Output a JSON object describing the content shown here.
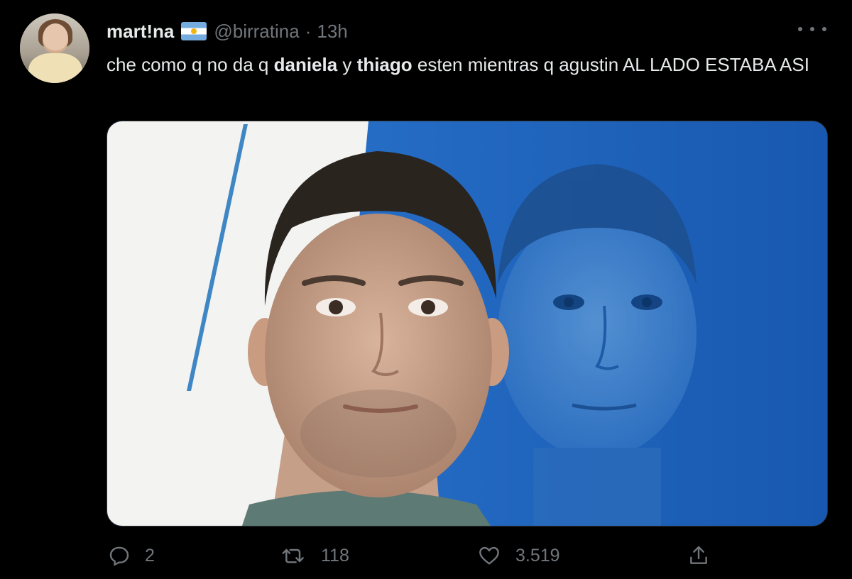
{
  "tweet": {
    "author": {
      "display_name": "mart!na",
      "flag_icon": "argentina-flag-icon",
      "handle": "@birratina",
      "separator": "·",
      "time": "13h"
    },
    "text": {
      "part1": "che como q no da q ",
      "bold1": "daniela",
      "part2": " y ",
      "bold2": "thiago",
      "part3": " esten mientras q agustin AL LADO ESTABA ASI"
    },
    "media": {
      "type": "photo",
      "colors": {
        "left_background": "#f2f2f0",
        "right_background": "#1c63c0",
        "stripe": "#4a8fc7"
      }
    },
    "actions": {
      "reply": {
        "icon": "reply-icon",
        "count": "2"
      },
      "retweet": {
        "icon": "retweet-icon",
        "count": "118"
      },
      "like": {
        "icon": "heart-icon",
        "count": "3.519"
      },
      "share": {
        "icon": "share-icon"
      }
    },
    "colors": {
      "background": "#000000",
      "text": "#e7e9ea",
      "secondary": "#71767b"
    }
  }
}
